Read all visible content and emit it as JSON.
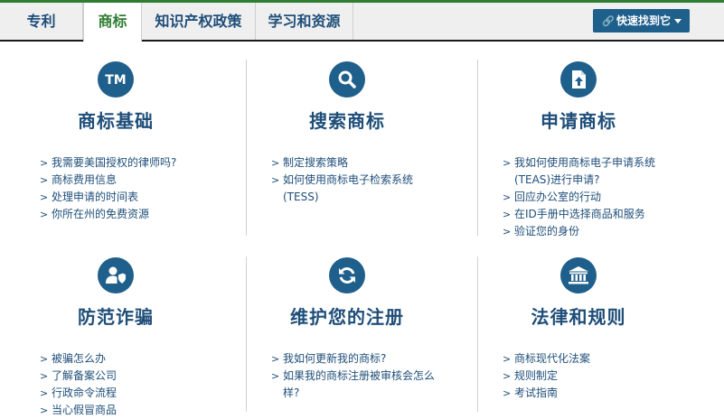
{
  "nav": {
    "tabs": [
      "专利",
      "商标",
      "知识产权政策",
      "学习和资源"
    ],
    "active_tab": "商标",
    "quick_button_label": "快速找到它"
  },
  "sections": [
    {
      "icon": "tm-icon",
      "title": "商标基础",
      "links": [
        "我需要美国授权的律师吗?",
        "商标费用信息",
        "处理申请的时间表",
        "你所在州的免费资源"
      ]
    },
    {
      "icon": "search-icon",
      "title": "搜索商标",
      "links": [
        "制定搜索策略",
        "如何使用商标电子检索系统(TESS)"
      ]
    },
    {
      "icon": "file-upload-icon",
      "title": "申请商标",
      "links": [
        "我如何使用商标电子申请系统(TEAS)进行申请?",
        "回应办公室的行动",
        "在ID手册中选择商品和服务",
        "验证您的身份"
      ]
    },
    {
      "icon": "user-shield-icon",
      "title": "防范诈骗",
      "links": [
        "被骗怎么办",
        "了解备案公司",
        "行政命令流程",
        "当心假冒商品"
      ]
    },
    {
      "icon": "refresh-icon",
      "title": "维护您的注册",
      "links": [
        "我如何更新我的商标?",
        "如果我的商标注册被审核会怎么样?"
      ]
    },
    {
      "icon": "bank-icon",
      "title": "法律和规则",
      "links": [
        "商标现代化法案",
        "规则制定",
        "考试指南"
      ]
    }
  ],
  "colors": {
    "accent_blue": "#1f5f8b",
    "title_blue": "#1f4e79",
    "active_green": "#2e7d32"
  }
}
